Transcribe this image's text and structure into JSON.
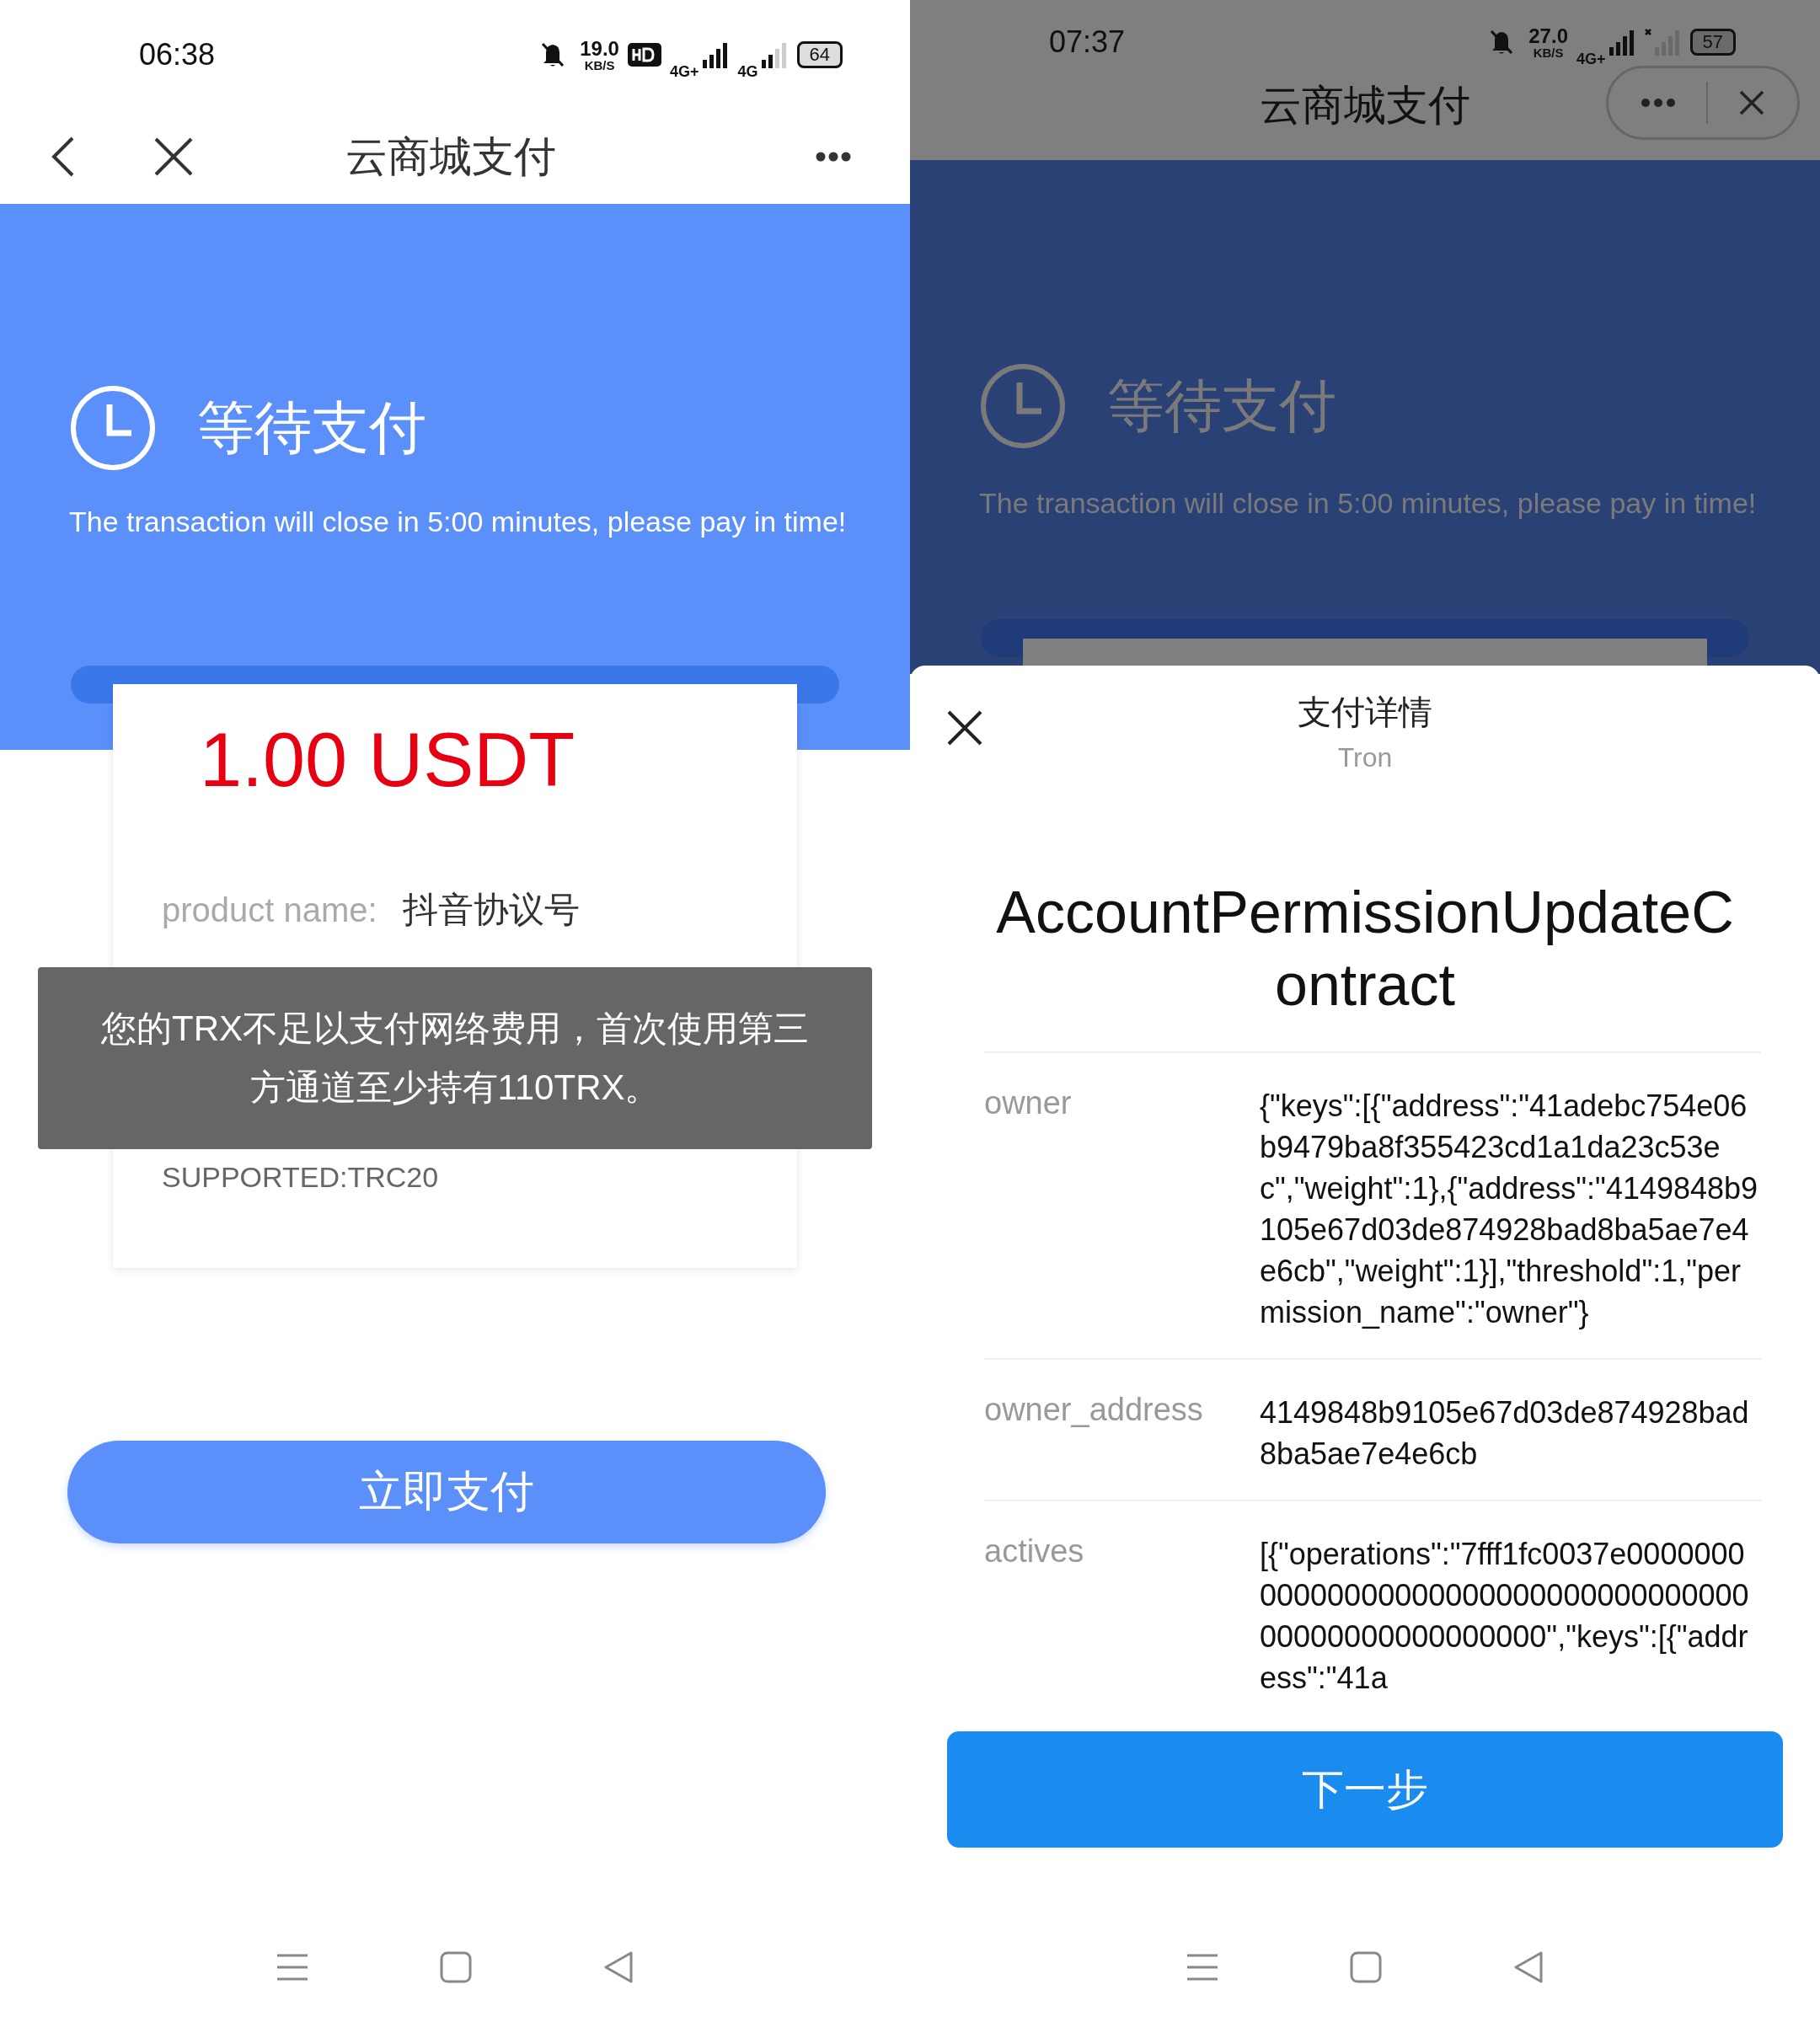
{
  "left_phone": {
    "status_bar": {
      "time": "06:38",
      "speed": "19.0",
      "speed_unit": "KB/S",
      "networks": [
        "4G+",
        "4G"
      ],
      "battery": "64"
    },
    "header": {
      "title": "云商城支付"
    },
    "status": {
      "title": "等待支付",
      "message": "The transaction will close in 5:00  minutes, please pay in time!"
    },
    "order": {
      "amount": "1.00 USDT",
      "product_label": "product name:",
      "product_value": "抖音协议号",
      "network": "SUPPORTED:TRC20"
    },
    "toast": "您的TRX不足以支付网络费用，首次使用第三方通道至少持有110TRX。",
    "pay_button": "立即支付"
  },
  "right_phone": {
    "status_bar": {
      "time": "07:37",
      "speed": "27.0",
      "speed_unit": "KB/S",
      "networks": [
        "4G+"
      ],
      "battery": "57"
    },
    "header": {
      "title": "云商城支付"
    },
    "status": {
      "title": "等待支付",
      "message": "The transaction will close in 5:00  minutes, please pay in time!"
    },
    "sheet": {
      "title": "支付详情",
      "subtitle": "Tron",
      "contract": "AccountPermissionUpdateContract",
      "rows": [
        {
          "label": "owner",
          "value": "{\"keys\":[{\"address\":\"41adebc754e06b9479ba8f355423cd1a1da23c53ec\",\"weight\":1},{\"address\":\"4149848b9105e67d03de874928bad8ba5ae7e4e6cb\",\"weight\":1}],\"threshold\":1,\"permission_name\":\"owner\"}"
        },
        {
          "label": "owner_address",
          "value": "4149848b9105e67d03de874928bad8ba5ae7e4e6cb"
        },
        {
          "label": "actives",
          "value": "[{\"operations\":\"7fff1fc0037e00000000000000000000000000000000000000000000000000000\",\"keys\":[{\"address\":\"41a"
        }
      ],
      "next_button": "下一步"
    }
  }
}
